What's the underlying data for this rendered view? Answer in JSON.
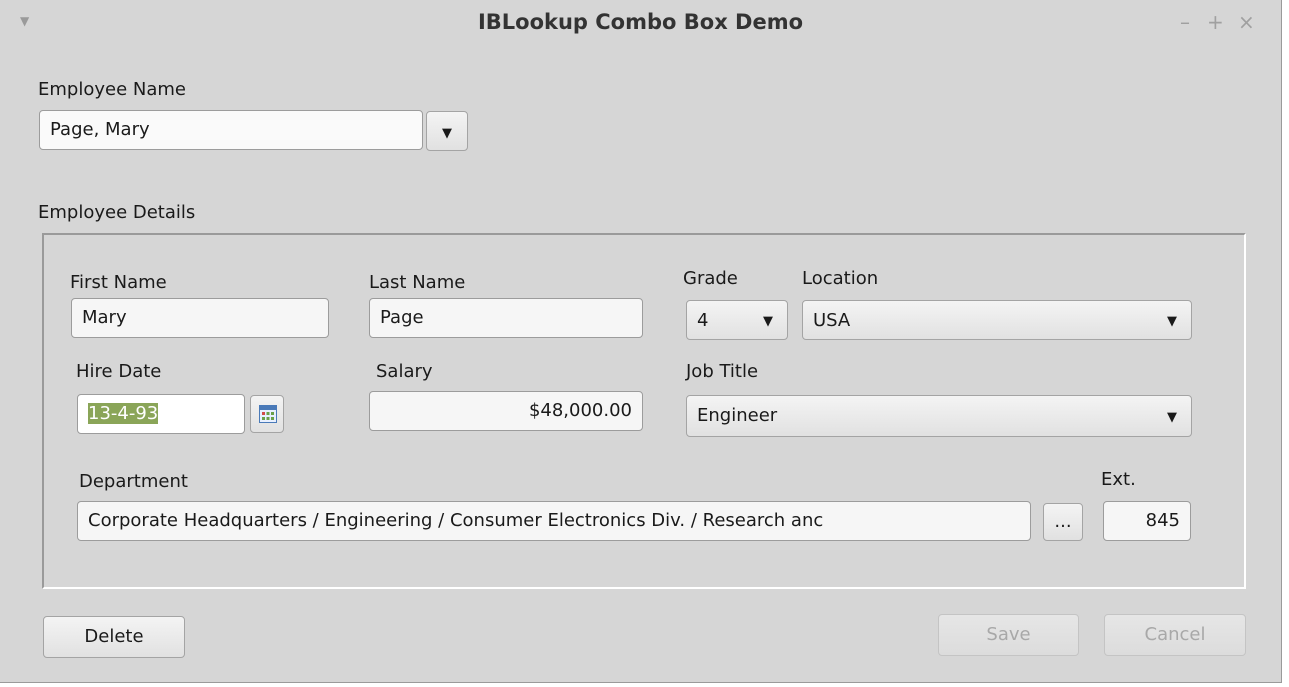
{
  "window": {
    "title": "IBLookup Combo Box Demo",
    "controls": {
      "minimize": "–",
      "maximize": "+",
      "close": "×"
    }
  },
  "employee_name": {
    "label": "Employee Name",
    "value": "Page, Mary"
  },
  "details": {
    "group_label": "Employee Details",
    "first_name": {
      "label": "First Name",
      "value": "Mary"
    },
    "last_name": {
      "label": "Last Name",
      "value": "Page"
    },
    "grade": {
      "label": "Grade",
      "value": "4"
    },
    "location": {
      "label": "Location",
      "value": "USA"
    },
    "hire_date": {
      "label": "Hire Date",
      "value": "13-4-93"
    },
    "salary": {
      "label": "Salary",
      "value": "$48,000.00"
    },
    "job_title": {
      "label": "Job Title",
      "value": "Engineer"
    },
    "department": {
      "label": "Department",
      "value": "Corporate Headquarters / Engineering / Consumer Electronics Div. / Research anc",
      "browse_label": "..."
    },
    "ext": {
      "label": "Ext.",
      "value": "845"
    }
  },
  "buttons": {
    "delete": "Delete",
    "save": "Save",
    "cancel": "Cancel"
  }
}
